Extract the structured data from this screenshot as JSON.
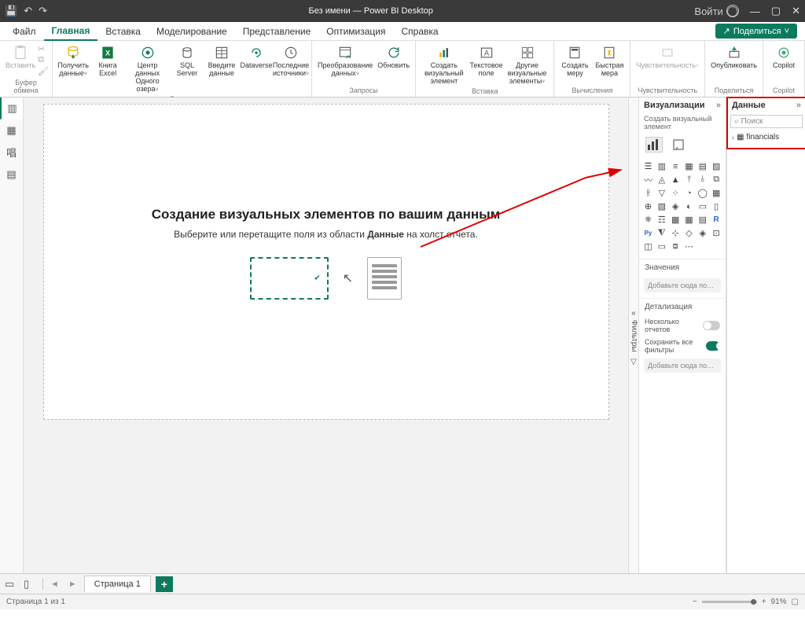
{
  "title": "Без имени — Power BI Desktop",
  "login": "Войти",
  "menubar": [
    "Файл",
    "Главная",
    "Вставка",
    "Моделирование",
    "Представление",
    "Оптимизация",
    "Справка"
  ],
  "share": "Поделиться",
  "ribbon": {
    "clip": {
      "paste": "Вставить",
      "label": "Буфер обмена"
    },
    "data": {
      "get": "Получить\nданные",
      "excel": "Книга\nExcel",
      "onelake": "Центр данных Одного\nозера",
      "sql": "SQL\nServer",
      "enter": "Введите\nданные",
      "dataverse": "Dataverse",
      "recent": "Последние\nисточники",
      "label": "Данные"
    },
    "queries": {
      "transform": "Преобразование\nданных",
      "refresh": "Обновить",
      "label": "Запросы"
    },
    "insert": {
      "visual": "Создать визуальный\nэлемент",
      "text": "Текстовое\nполе",
      "more": "Другие визуальные\nэлементы",
      "label": "Вставка"
    },
    "calc": {
      "measure": "Создать\nмеру",
      "quick": "Быстрая\nмера",
      "label": "Вычисления"
    },
    "sens": {
      "sens": "Чувствительность",
      "label": "Чувствительность"
    },
    "share2": {
      "pub": "Опубликовать",
      "label": "Поделиться"
    },
    "copilot": {
      "cop": "Copilot",
      "label": "Copilot"
    }
  },
  "canvas": {
    "h1": "Создание визуальных элементов по вашим данным",
    "h2a": "Выберите или перетащите поля из области ",
    "h2b": "Данные",
    "h2c": " на холст отчета."
  },
  "filters": "Фильтры",
  "viz": {
    "title": "Визуализации",
    "sub": "Создать визуальный элемент",
    "values": "Значения",
    "addfields": "Добавьте сюда поля с дан...",
    "drill": "Детализация",
    "cross": "Несколько отчетов",
    "keep": "Сохранить все фильтры",
    "adddrill": "Добавьте сюда поля дета..."
  },
  "dataPane": {
    "title": "Данные",
    "search": "Поиск",
    "table": "financials"
  },
  "page": {
    "tab": "Страница 1"
  },
  "status": {
    "page": "Страница 1 из 1",
    "zoom": "91%"
  }
}
